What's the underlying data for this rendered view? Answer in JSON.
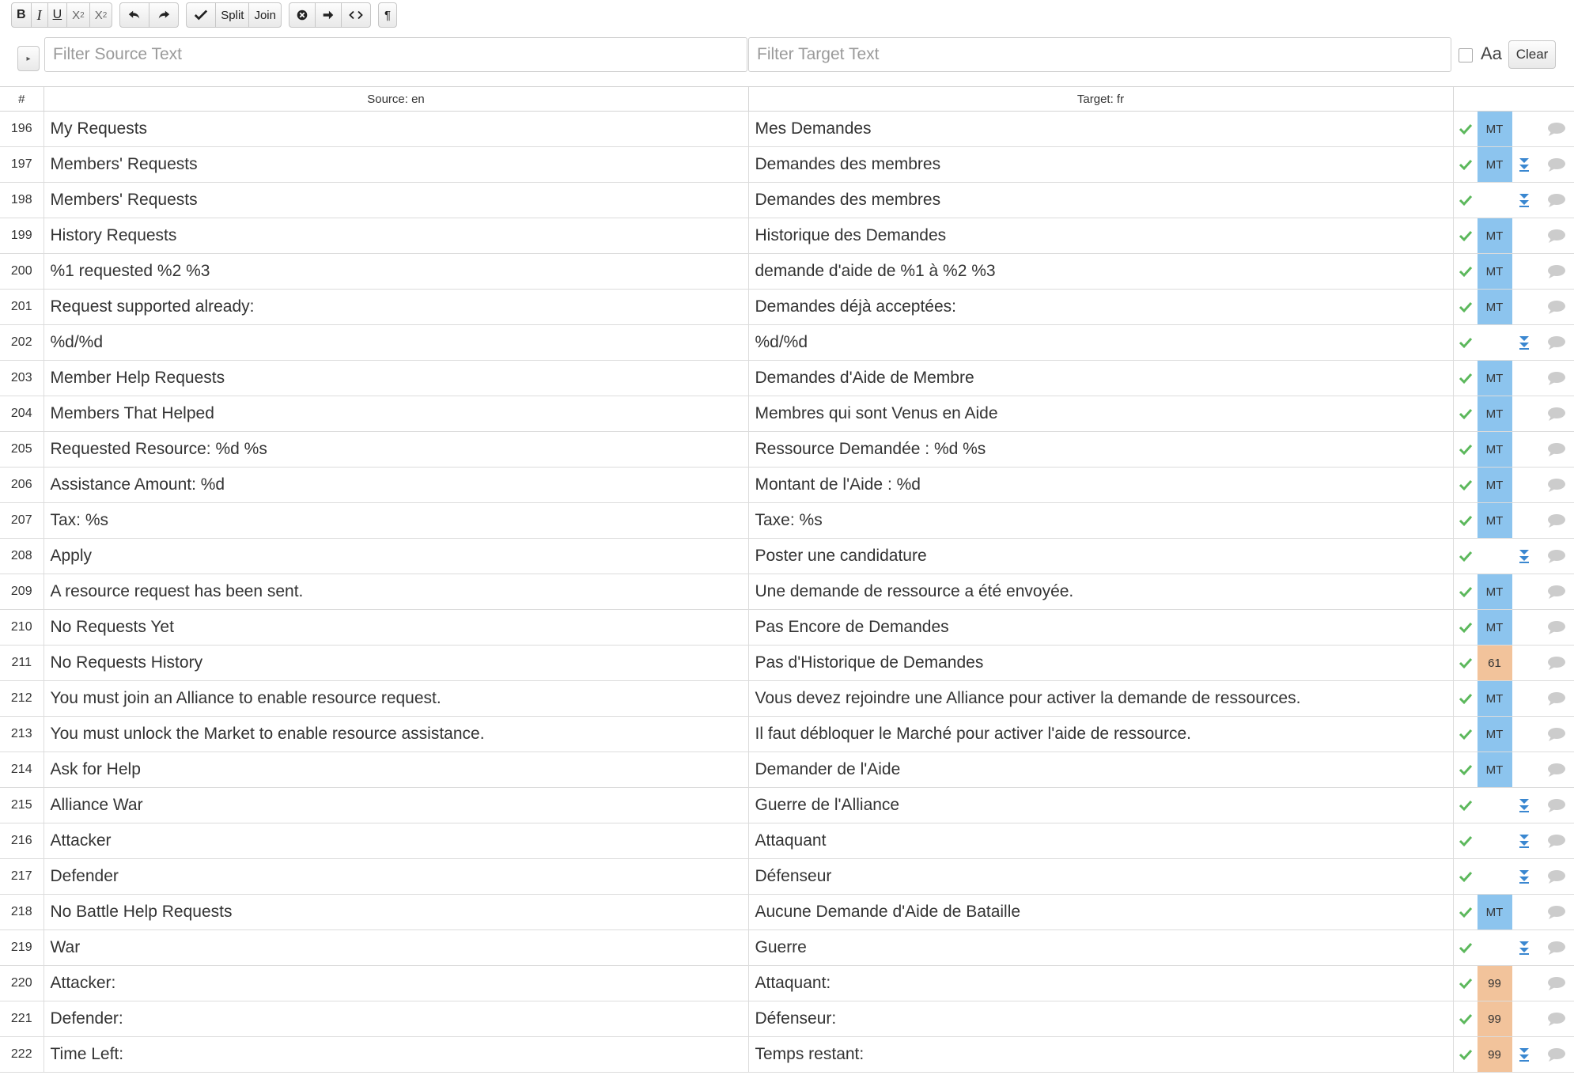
{
  "toolbar": {
    "bold": "B",
    "italic": "I",
    "underline": "U",
    "subscript": "X",
    "subscript_mark": "2",
    "superscript": "X",
    "superscript_mark": "2",
    "split": "Split",
    "join": "Join",
    "pilcrow": "¶"
  },
  "filters": {
    "source_placeholder": "Filter Source Text",
    "target_placeholder": "Filter Target Text",
    "case_label": "Aa",
    "clear_label": "Clear"
  },
  "columns": {
    "num": "#",
    "source": "Source: en",
    "target": "Target: fr"
  },
  "colors": {
    "mt": "#8cc4ee",
    "fuzzy": "#f2c39b",
    "check": "#5cb85c",
    "arrow": "#3a87d0",
    "comment": "#cccccc"
  },
  "rows": [
    {
      "num": "196",
      "source": "My Requests",
      "target": "Mes Demandes",
      "badge": "MT",
      "type": "mt",
      "dbl": false
    },
    {
      "num": "197",
      "source": "Members' Requests",
      "target": "Demandes des membres",
      "badge": "MT",
      "type": "mt",
      "dbl": true
    },
    {
      "num": "198",
      "source": "Members' Requests",
      "target": "Demandes des membres",
      "badge": "",
      "type": "none",
      "dbl": true
    },
    {
      "num": "199",
      "source": "History Requests",
      "target": "Historique des Demandes",
      "badge": "MT",
      "type": "mt",
      "dbl": false
    },
    {
      "num": "200",
      "source": "%1 requested %2 %3",
      "target": "demande d'aide de %1 à %2 %3",
      "badge": "MT",
      "type": "mt",
      "dbl": false
    },
    {
      "num": "201",
      "source": "Request supported already:",
      "target": "Demandes déjà acceptées:",
      "badge": "MT",
      "type": "mt",
      "dbl": false
    },
    {
      "num": "202",
      "source": "%d/%d",
      "target": "%d/%d",
      "badge": "",
      "type": "none",
      "dbl": true
    },
    {
      "num": "203",
      "source": "Member Help Requests",
      "target": "Demandes d'Aide de Membre",
      "badge": "MT",
      "type": "mt",
      "dbl": false
    },
    {
      "num": "204",
      "source": "Members That Helped",
      "target": "Membres qui sont Venus en Aide",
      "badge": "MT",
      "type": "mt",
      "dbl": false
    },
    {
      "num": "205",
      "source": "Requested Resource: %d %s",
      "target": "Ressource Demandée : %d %s",
      "badge": "MT",
      "type": "mt",
      "dbl": false
    },
    {
      "num": "206",
      "source": "Assistance Amount: %d",
      "target": "Montant de l'Aide : %d",
      "badge": "MT",
      "type": "mt",
      "dbl": false
    },
    {
      "num": "207",
      "source": "Tax: %s",
      "target": "Taxe: %s",
      "badge": "MT",
      "type": "mt",
      "dbl": false
    },
    {
      "num": "208",
      "source": "Apply",
      "target": "Poster une candidature",
      "badge": "",
      "type": "none",
      "dbl": true
    },
    {
      "num": "209",
      "source": "A resource request has been sent.",
      "target": "Une demande de ressource a été envoyée.",
      "badge": "MT",
      "type": "mt",
      "dbl": false
    },
    {
      "num": "210",
      "source": "No Requests Yet",
      "target": "Pas Encore de Demandes",
      "badge": "MT",
      "type": "mt",
      "dbl": false
    },
    {
      "num": "211",
      "source": "No Requests History",
      "target": "Pas d'Historique de Demandes",
      "badge": "61",
      "type": "fz",
      "dbl": false
    },
    {
      "num": "212",
      "source": "You must join an Alliance to enable resource request.",
      "target": "Vous devez rejoindre une Alliance pour activer la demande de ressources.",
      "badge": "MT",
      "type": "mt",
      "dbl": false
    },
    {
      "num": "213",
      "source": "You must unlock the Market to enable resource assistance.",
      "target": "Il faut débloquer le Marché pour activer l'aide de ressource.",
      "badge": "MT",
      "type": "mt",
      "dbl": false
    },
    {
      "num": "214",
      "source": "Ask for Help",
      "target": "Demander de l'Aide",
      "badge": "MT",
      "type": "mt",
      "dbl": false
    },
    {
      "num": "215",
      "source": "Alliance War",
      "target": "Guerre de l'Alliance",
      "badge": "",
      "type": "none",
      "dbl": true
    },
    {
      "num": "216",
      "source": "Attacker",
      "target": "Attaquant",
      "badge": "",
      "type": "none",
      "dbl": true
    },
    {
      "num": "217",
      "source": "Defender",
      "target": "Défenseur",
      "badge": "",
      "type": "none",
      "dbl": true
    },
    {
      "num": "218",
      "source": "No Battle Help Requests",
      "target": "Aucune Demande d'Aide de Bataille",
      "badge": "MT",
      "type": "mt",
      "dbl": false
    },
    {
      "num": "219",
      "source": "War",
      "target": "Guerre",
      "badge": "",
      "type": "none",
      "dbl": true
    },
    {
      "num": "220",
      "source": "Attacker:",
      "target": "Attaquant:",
      "badge": "99",
      "type": "fz",
      "dbl": false
    },
    {
      "num": "221",
      "source": "Defender:",
      "target": "Défenseur:",
      "badge": "99",
      "type": "fz",
      "dbl": false
    },
    {
      "num": "222",
      "source": "Time Left:",
      "target": "Temps restant:",
      "badge": "99",
      "type": "fz",
      "dbl": true
    }
  ]
}
